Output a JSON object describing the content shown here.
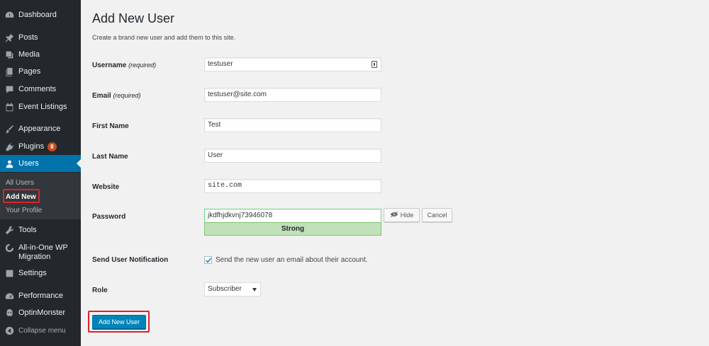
{
  "sidebar": {
    "items": [
      {
        "label": "Dashboard",
        "icon": "dashboard-icon"
      },
      {
        "label": "Posts",
        "icon": "pin-icon"
      },
      {
        "label": "Media",
        "icon": "media-icon"
      },
      {
        "label": "Pages",
        "icon": "pages-icon"
      },
      {
        "label": "Comments",
        "icon": "comment-icon"
      },
      {
        "label": "Event Listings",
        "icon": "calendar-icon"
      },
      {
        "label": "Appearance",
        "icon": "brush-icon"
      },
      {
        "label": "Plugins",
        "icon": "plugin-icon",
        "badge": "8"
      },
      {
        "label": "Users",
        "icon": "user-icon"
      },
      {
        "label": "Tools",
        "icon": "wrench-icon"
      },
      {
        "label": "All-in-One WP Migration",
        "icon": "migration-icon"
      },
      {
        "label": "Settings",
        "icon": "settings-icon"
      },
      {
        "label": "Performance",
        "icon": "performance-icon"
      },
      {
        "label": "OptinMonster",
        "icon": "optinmonster-icon"
      },
      {
        "label": "Collapse menu",
        "icon": "collapse-icon"
      }
    ],
    "submenu": [
      "All Users",
      "Add New",
      "Your Profile"
    ]
  },
  "page": {
    "title": "Add New User",
    "description": "Create a brand new user and add them to this site."
  },
  "form": {
    "username_label": "Username",
    "required_note": "(required)",
    "username_value": "testuser",
    "email_label": "Email",
    "email_value": "testuser@site.com",
    "first_name_label": "First Name",
    "first_name_value": "Test",
    "last_name_label": "Last Name",
    "last_name_value": "User",
    "website_label": "Website",
    "website_value": "site.com",
    "password_label": "Password",
    "password_value": "jkdfhjdkvnj73946078",
    "password_strength": "Strong",
    "hide_label": "Hide",
    "cancel_label": "Cancel",
    "notification_label": "Send User Notification",
    "notification_text": "Send the new user an email about their account.",
    "notification_checked": true,
    "role_label": "Role",
    "role_value": "Subscriber",
    "submit_label": "Add New User"
  },
  "colors": {
    "sidebar_bg": "#23282d",
    "accent": "#0073aa",
    "button_primary": "#0085ba",
    "strength_good": "#c1e1b9",
    "highlight": "#d9232d"
  }
}
